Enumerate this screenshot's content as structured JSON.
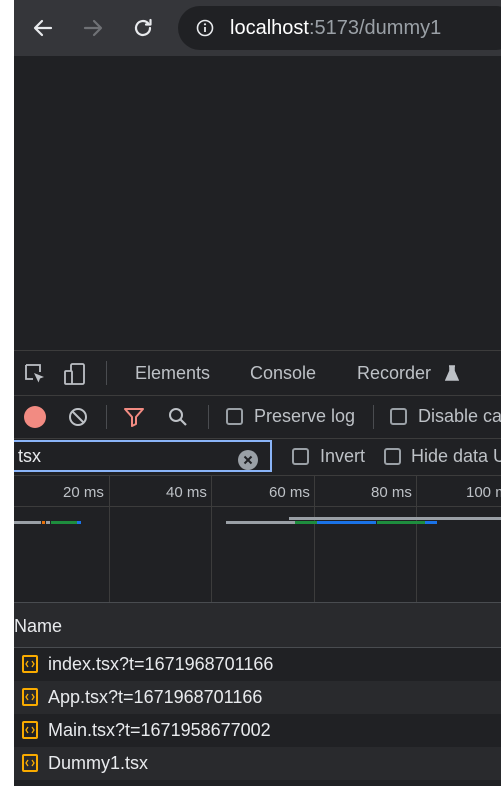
{
  "browser": {
    "url_host": "localhost",
    "url_path": ":5173/dummy1",
    "icons": [
      "back-arrow-icon",
      "forward-arrow-icon",
      "reload-icon",
      "info-icon"
    ]
  },
  "devtools": {
    "tabs": [
      "Elements",
      "Console",
      "Recorder"
    ],
    "toolbar": {
      "preserve_log_label": "Preserve log",
      "disable_cache_label": "Disable ca"
    },
    "filter": {
      "value": "tsx",
      "invert_label": "Invert",
      "hide_data_label": "Hide data U"
    },
    "timeline": {
      "ticks": [
        "20 ms",
        "40 ms",
        "60 ms",
        "80 ms",
        "100 m"
      ],
      "segment_colors": {
        "gray": "#9aa0a6",
        "red": "#e8710a",
        "green": "#1e8e3e",
        "blue": "#1a73e8"
      }
    },
    "table": {
      "column_name": "Name",
      "rows": [
        "index.tsx?t=1671968701166",
        "App.tsx?t=1671968701166",
        "Main.tsx?t=1671958677002",
        "Dummy1.tsx"
      ]
    }
  },
  "colors": {
    "accent": "#8ab4f8",
    "record": "#f28b82",
    "file_icon": "#f9ab00"
  }
}
